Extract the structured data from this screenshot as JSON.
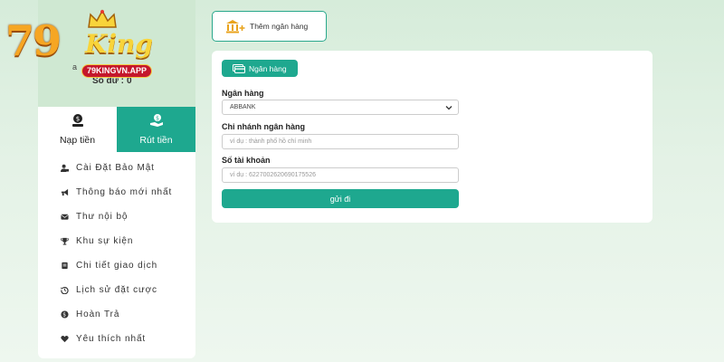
{
  "logo": {
    "number": "79",
    "word": "King",
    "domain": "79KINGVN.APP"
  },
  "profile": {
    "username_suffix": "a",
    "balance_label": "Số dư :",
    "balance_value": "0"
  },
  "tabs": [
    {
      "label": "Nạp tiền",
      "icon": "deposit-icon"
    },
    {
      "label": "Rút tiền",
      "icon": "withdraw-icon",
      "active": true
    }
  ],
  "menu": [
    {
      "label": "Cài Đặt Bảo Mật",
      "icon": "user-lock-icon"
    },
    {
      "label": "Thông báo mới nhất",
      "icon": "megaphone-icon"
    },
    {
      "label": "Thư nội bộ",
      "icon": "envelope-icon"
    },
    {
      "label": "Khu sự kiện",
      "icon": "trophy-icon"
    },
    {
      "label": "Chi tiết giao dịch",
      "icon": "receipt-icon"
    },
    {
      "label": "Lịch sử đặt cược",
      "icon": "history-icon"
    },
    {
      "label": "Hoàn Trả",
      "icon": "coin-icon"
    },
    {
      "label": "Yêu thích nhất",
      "icon": "heart-icon"
    }
  ],
  "add_bank": {
    "label": "Thêm ngân hàng",
    "icon": "bank-plus-icon"
  },
  "form": {
    "tab_label": "Ngân hàng",
    "bank": {
      "label": "Ngân hàng",
      "value": "ABBANK"
    },
    "branch": {
      "label": "Chi nhánh ngân hàng",
      "placeholder": "ví dụ : thành phố hồ chí minh"
    },
    "account": {
      "label": "Số tài khoản",
      "placeholder": "ví dụ : 6227002620690175526"
    },
    "submit_label": "gửi đi"
  },
  "colors": {
    "accent": "#1ea88f",
    "background": "#d6ecda",
    "logo_gold": "#f6a623",
    "logo_badge": "#c4172c"
  }
}
